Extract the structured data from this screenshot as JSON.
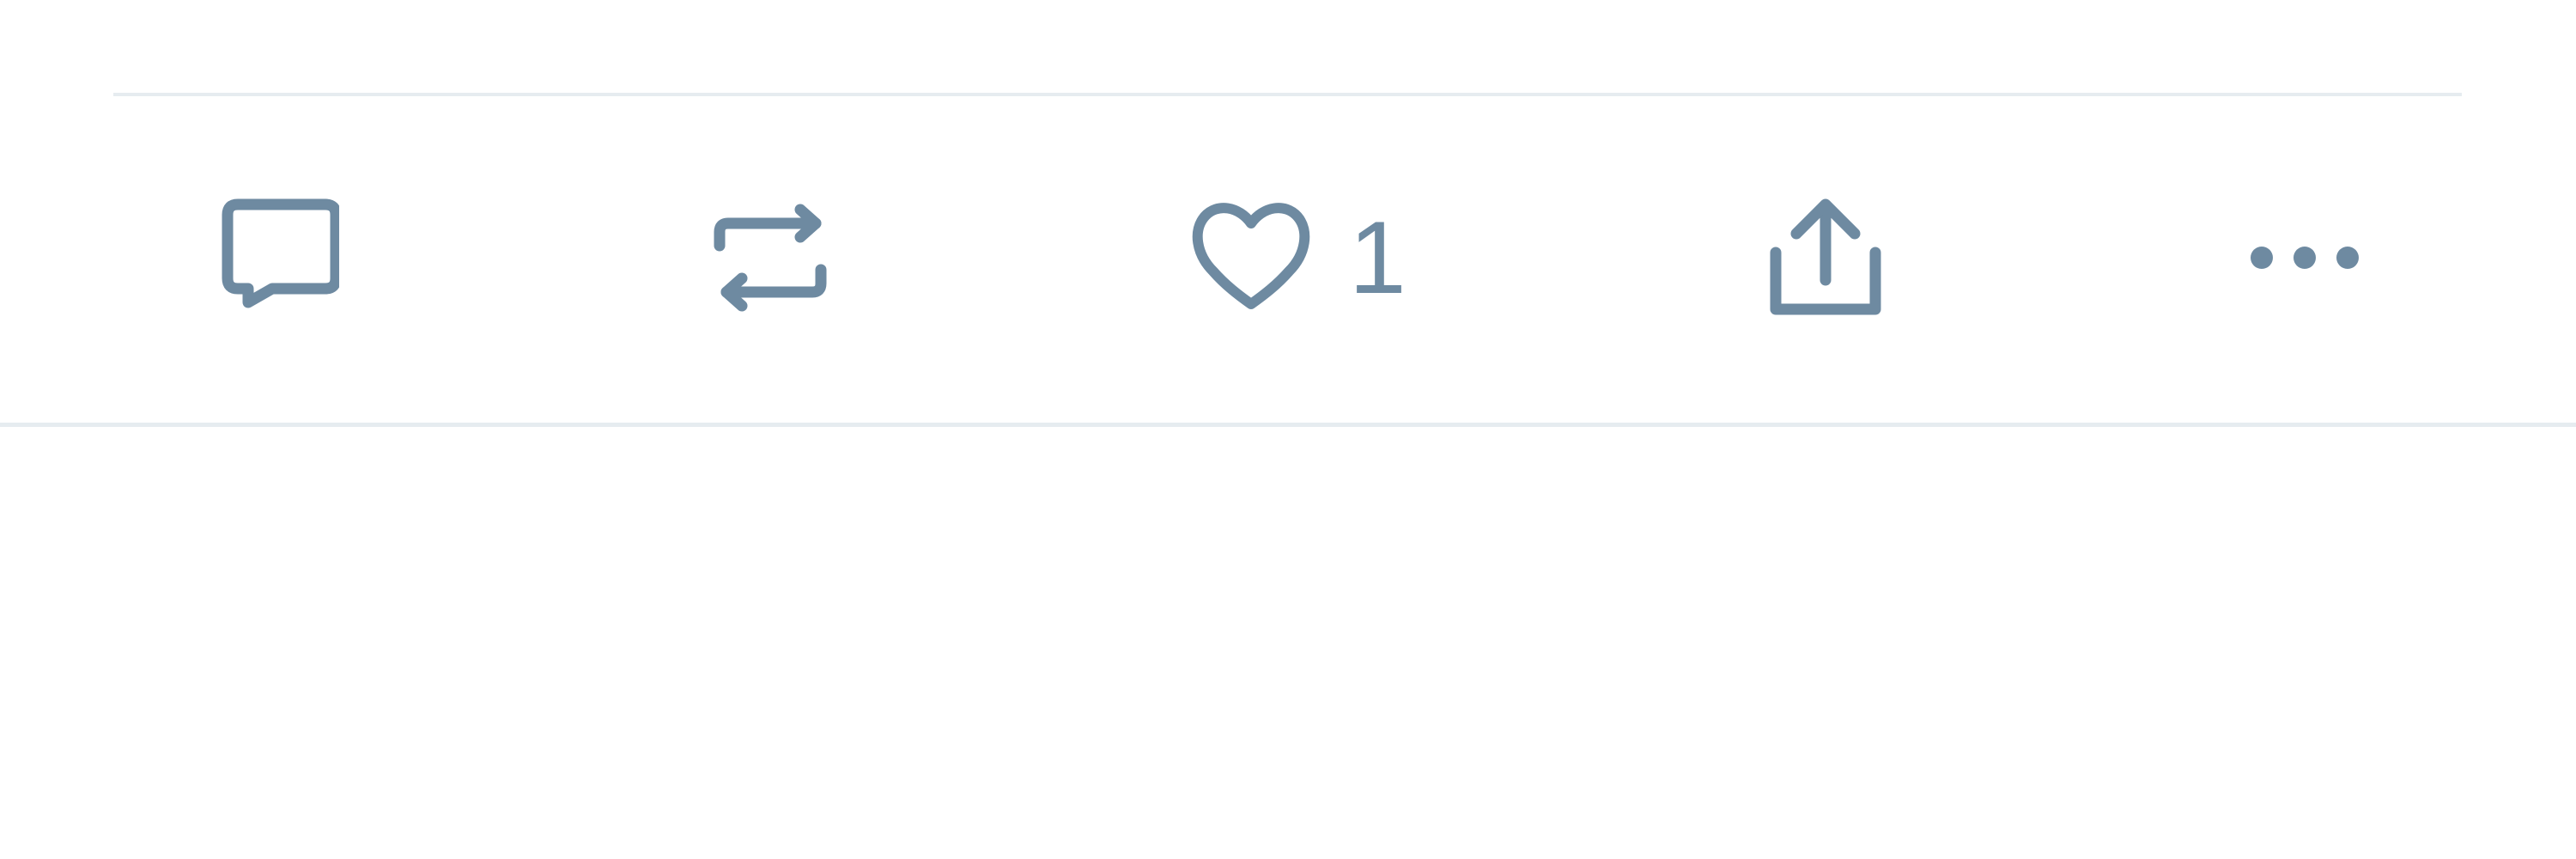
{
  "tweet_actions": {
    "reply": {
      "icon": "reply-icon",
      "count": ""
    },
    "retweet": {
      "icon": "retweet-icon",
      "count": ""
    },
    "like": {
      "icon": "heart-icon",
      "count": "1"
    },
    "share": {
      "icon": "share-icon",
      "count": ""
    },
    "more": {
      "icon": "more-icon"
    }
  },
  "colors": {
    "icon": "#6e8aa1",
    "divider": "#e6ecf0",
    "background": "#ffffff"
  }
}
